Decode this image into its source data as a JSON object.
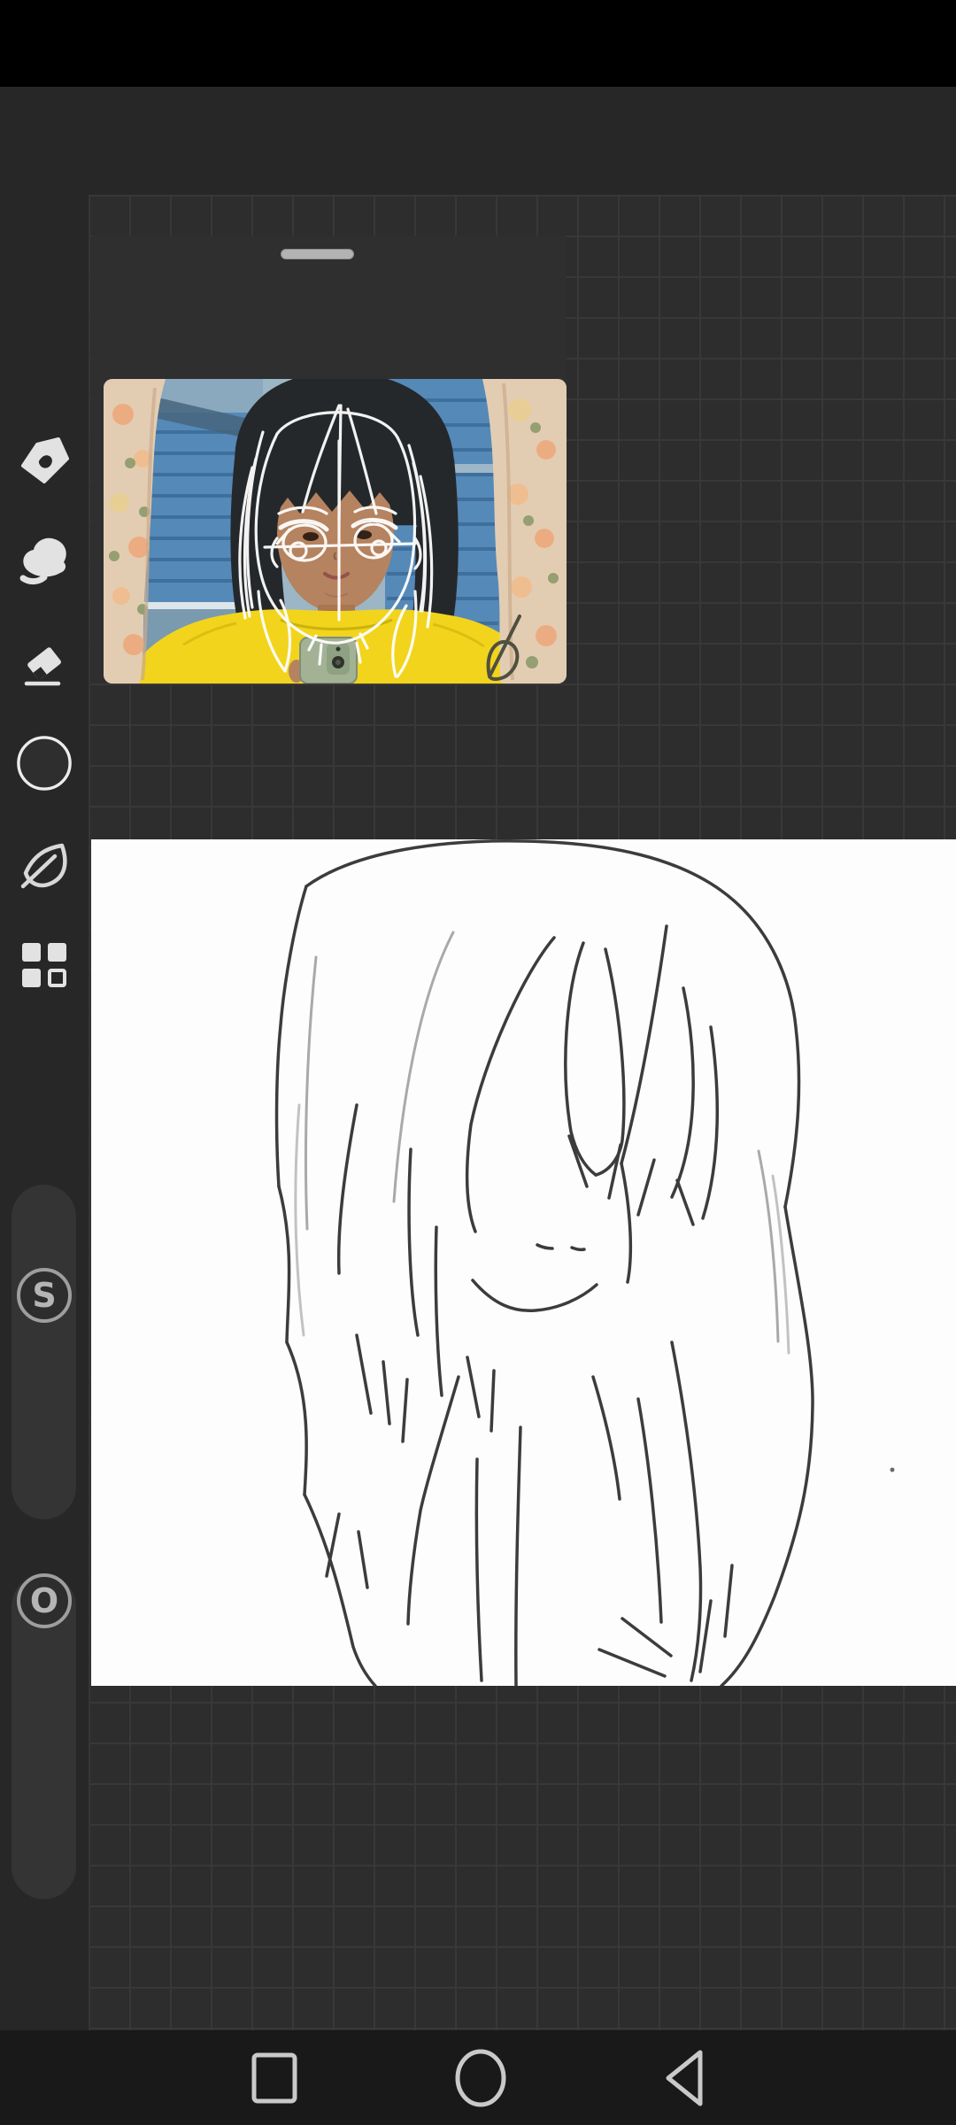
{
  "toolbar": {
    "icons": [
      {
        "name": "close-icon"
      },
      {
        "name": "undo-icon",
        "enabled": true
      },
      {
        "name": "redo-icon",
        "enabled": false
      },
      {
        "name": "layers-icon"
      },
      {
        "name": "import-folder-cloud-icon"
      },
      {
        "name": "settings-gear-icon"
      },
      {
        "name": "share-icon"
      }
    ]
  },
  "sidebar": {
    "tools": [
      {
        "name": "pen-tool-icon"
      },
      {
        "name": "smudge-tool-icon"
      },
      {
        "name": "eraser-tool-icon"
      },
      {
        "name": "color-circle-icon"
      },
      {
        "name": "leaf-tool-icon"
      },
      {
        "name": "materials-grid-icon"
      }
    ]
  },
  "reference_window": {
    "handle": "drag-handle",
    "photo": "mirror selfie of child in yellow shirt in front of blue house with floral curtains, white anime face construction lines drawn over the face"
  },
  "canvas": {
    "content": "pencil sketch of a long-haired character with swept bangs, face mostly hidden, dashed mouth"
  },
  "sliders": {
    "size": {
      "label": "S",
      "position": "33%"
    },
    "opacity": {
      "label": "O",
      "position": "top"
    }
  },
  "nav_bar": {
    "buttons": [
      {
        "name": "recents-button"
      },
      {
        "name": "home-button"
      },
      {
        "name": "back-button"
      }
    ]
  },
  "colors": {
    "chrome_bg": "#272727",
    "canvas_area_bg": "#2d2d2d",
    "grid_line": "#383838",
    "status_bar": "#000000",
    "nav_bar": "#191919",
    "icon_light": "#dcdcdc",
    "icon_undo": "#949494",
    "icon_redo_disabled": "#5a5a5a",
    "white_canvas": "#fdfdfd",
    "sketch_stroke": "#3c3c3c",
    "shirt_yellow": "#f2d41d",
    "shutter_blue": "#5589b8",
    "curtain_cream": "#e3cdb2"
  }
}
